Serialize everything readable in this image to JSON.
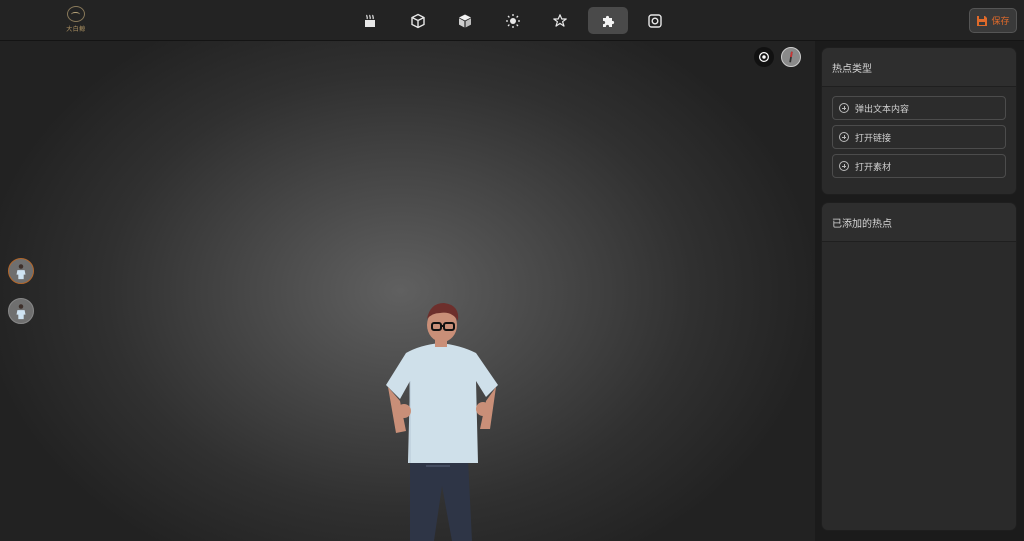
{
  "logo": {
    "text": "大白鲸"
  },
  "toolbar": {
    "tools": [
      {
        "name": "environment",
        "icon": "scene-icon"
      },
      {
        "name": "model",
        "icon": "cube-outline-icon"
      },
      {
        "name": "material",
        "icon": "cube-solid-icon"
      },
      {
        "name": "lighting",
        "icon": "sun-icon"
      },
      {
        "name": "favorite",
        "icon": "star-icon"
      },
      {
        "name": "hotspot",
        "icon": "puzzle-icon",
        "active": true
      },
      {
        "name": "snapshot",
        "icon": "camera-icon"
      }
    ],
    "save_label": "保存",
    "accent_color": "#e06a2a"
  },
  "hotspot_types": {
    "title": "热点类型",
    "items": [
      {
        "label": "弹出文本内容"
      },
      {
        "label": "打开链接"
      },
      {
        "label": "打开素材"
      }
    ]
  },
  "added_hotspots": {
    "title": "已添加的热点",
    "items": []
  }
}
